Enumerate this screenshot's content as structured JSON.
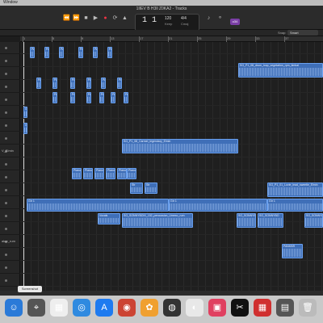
{
  "menubar": {
    "item": "Window"
  },
  "window": {
    "title": "1IIEV B H3ll Z0KA2 - Tracks"
  },
  "lcd": {
    "bars": "1  1",
    "tempo": "120",
    "tempo_sub": "Keep",
    "signature": "4/4",
    "key": "Cmaj"
  },
  "mode_badge": "o34",
  "snap": {
    "label": "Snap:",
    "value": "Smart"
  },
  "ruler": [
    "1",
    "5",
    "9",
    "13",
    "17",
    "21",
    "25",
    "29",
    "33",
    "37"
  ],
  "tracks": [
    "",
    "",
    "",
    "",
    "",
    "",
    "",
    "",
    "V_Elmin",
    "",
    "",
    "",
    "",
    "",
    "",
    "aker_rum",
    "",
    "",
    ""
  ],
  "regions": [
    {
      "label": "SG_P1_08_drum_loop_vegetation_rpm_timbal",
      "color": "#3f6fb8"
    },
    {
      "label": "SG_P1_08_Carmel_legendary_Elmin",
      "color": "#3f6fb8"
    },
    {
      "label": "SG_P1_01_Lovie_lead_sweetie_Elmin",
      "color": "#3f6fb8"
    },
    {
      "label": "SG_SONNYBOIX_152_percussion_Umexo_rum",
      "color": "#3f6fb8"
    },
    {
      "label": "Piano",
      "color": "#3f6fb8"
    },
    {
      "label": "Gtr",
      "color": "#3f6fb8"
    },
    {
      "label": "Str",
      "color": "#3f6fb8"
    },
    {
      "label": "Vocals",
      "color": "#3f6fb8"
    },
    {
      "label": "Gtr 1",
      "color": "#3f6fb8"
    },
    {
      "label": "SG_SONNYBO",
      "color": "#3f6fb8"
    },
    {
      "label": "PANKBR",
      "color": "#3f6fb8"
    }
  ],
  "tooltip": "Screenshot",
  "dock": [
    {
      "icon": "finder-icon",
      "color": "#2a7ad8",
      "glyph": "☺"
    },
    {
      "icon": "screenshot-icon",
      "color": "#555",
      "glyph": "⌖"
    },
    {
      "icon": "calendar-icon",
      "color": "#eee",
      "glyph": "▦"
    },
    {
      "icon": "safari-icon",
      "color": "#2f8ae0",
      "glyph": "◎"
    },
    {
      "icon": "app-store-icon",
      "color": "#1e7bf0",
      "glyph": "A"
    },
    {
      "icon": "photo-booth-icon",
      "color": "#c43",
      "glyph": "◉"
    },
    {
      "icon": "photos-icon",
      "color": "#f0a030",
      "glyph": "✿"
    },
    {
      "icon": "logic-pro-icon",
      "color": "#333",
      "glyph": "◍"
    },
    {
      "icon": "chrome-icon",
      "color": "#e8e8e8",
      "glyph": "◐"
    },
    {
      "icon": "recorder-icon",
      "color": "#e04060",
      "glyph": "▣"
    },
    {
      "icon": "capcut-icon",
      "color": "#111",
      "glyph": "✂"
    },
    {
      "icon": "launchpad-icon",
      "color": "#d03030",
      "glyph": "▦"
    },
    {
      "icon": "calculator-icon",
      "color": "#555",
      "glyph": "▤"
    },
    {
      "icon": "trash-icon",
      "color": "#bbb",
      "glyph": "🗑"
    }
  ]
}
